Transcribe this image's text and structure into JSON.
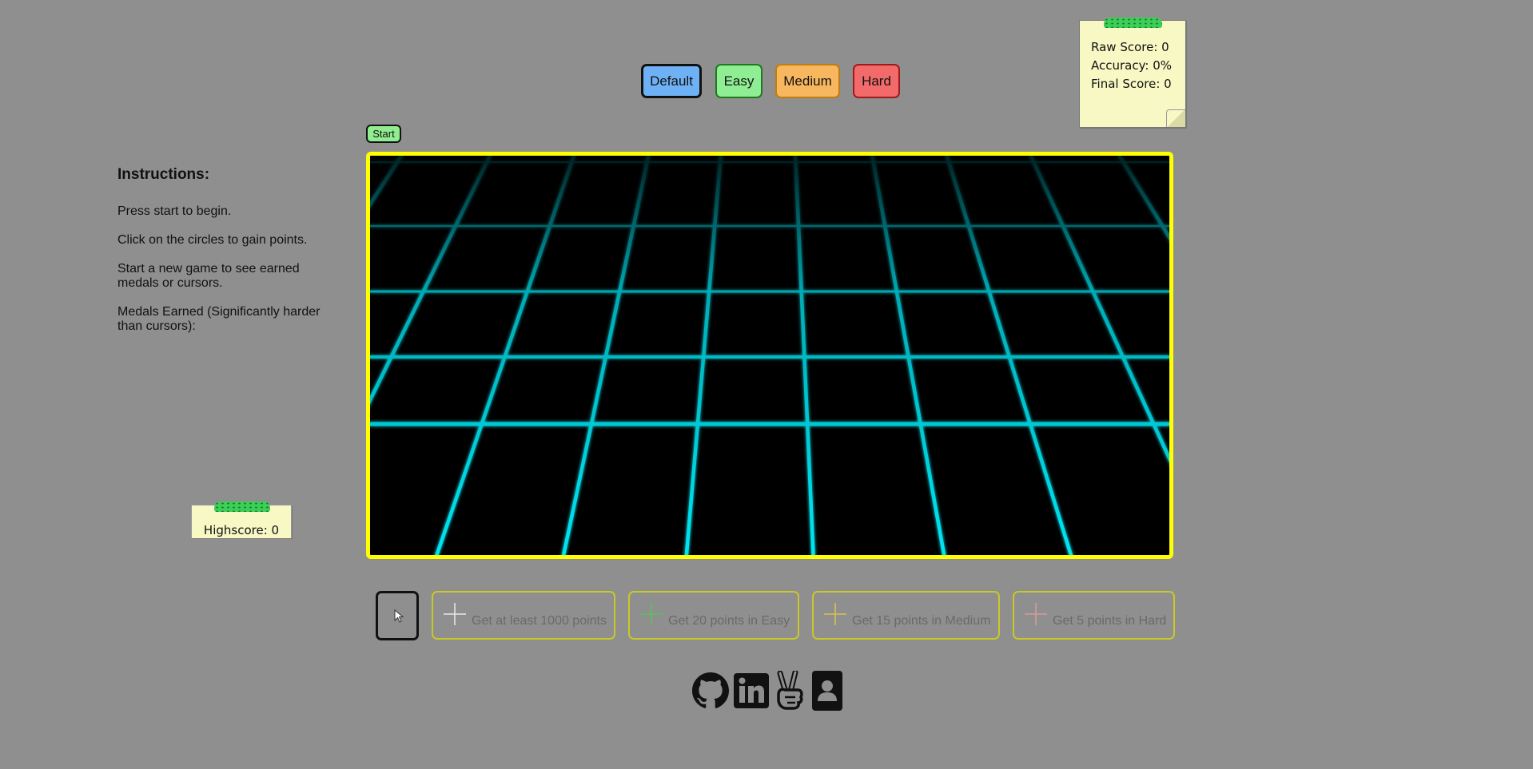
{
  "difficulty": {
    "default_label": "Default",
    "easy_label": "Easy",
    "medium_label": "Medium",
    "hard_label": "Hard"
  },
  "colors": {
    "default": "#6fb1f5",
    "easy": "#8fee93",
    "medium": "#f7b75e",
    "hard": "#f26a6a",
    "frame": "#ffff00",
    "grid": "#00e5f2",
    "background": "#8f8f8f"
  },
  "score": {
    "raw": "Raw Score: 0",
    "accuracy": "Accuracy: 0%",
    "final": "Final Score: 0"
  },
  "highscore": "Highscore: 0",
  "start_label": "Start",
  "instructions": {
    "heading": "Instructions:",
    "step1": "Press start to begin.",
    "step2": "Click on the circles to gain points.",
    "step3": "Start a new game to see earned medals or cursors.",
    "step4": "Medals Earned (Significantly harder than cursors):"
  },
  "medals": [
    {
      "label": "Get at least 1000 points",
      "icon": "plus-white-icon"
    },
    {
      "label": "Get 20 points in Easy",
      "icon": "plus-green-icon"
    },
    {
      "label": "Get 15 points in Medium",
      "icon": "plus-yellow-icon"
    },
    {
      "label": "Get 5 points in Hard",
      "icon": "plus-pink-icon"
    }
  ],
  "social_icons": [
    "github-icon",
    "linkedin-icon",
    "peace-hand-icon",
    "contact-card-icon"
  ]
}
